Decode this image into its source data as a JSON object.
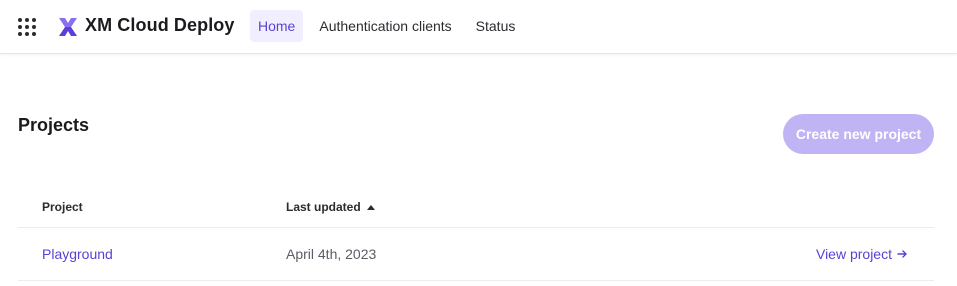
{
  "header": {
    "app_title": "XM Cloud Deploy",
    "nav": [
      {
        "label": "Home",
        "active": true
      },
      {
        "label": "Authentication clients",
        "active": false
      },
      {
        "label": "Status",
        "active": false
      }
    ]
  },
  "main": {
    "title": "Projects",
    "create_button": "Create new project",
    "table": {
      "columns": [
        "Project",
        "Last updated"
      ],
      "sort": {
        "column": "Last updated",
        "direction": "ascending"
      },
      "rows": [
        {
          "project": "Playground",
          "last_updated": "April 4th, 2023",
          "action": "View project"
        }
      ]
    }
  },
  "icons": {
    "app_switcher": "grid-icon",
    "logo": "xm-cloud-logo-icon",
    "sort": "sort-ascending-icon",
    "view": "arrow-right-icon"
  },
  "colors": {
    "accent": "#5b3fd6",
    "active_nav_bg": "#f1efff",
    "button_disabled": "#c0b4f4"
  }
}
